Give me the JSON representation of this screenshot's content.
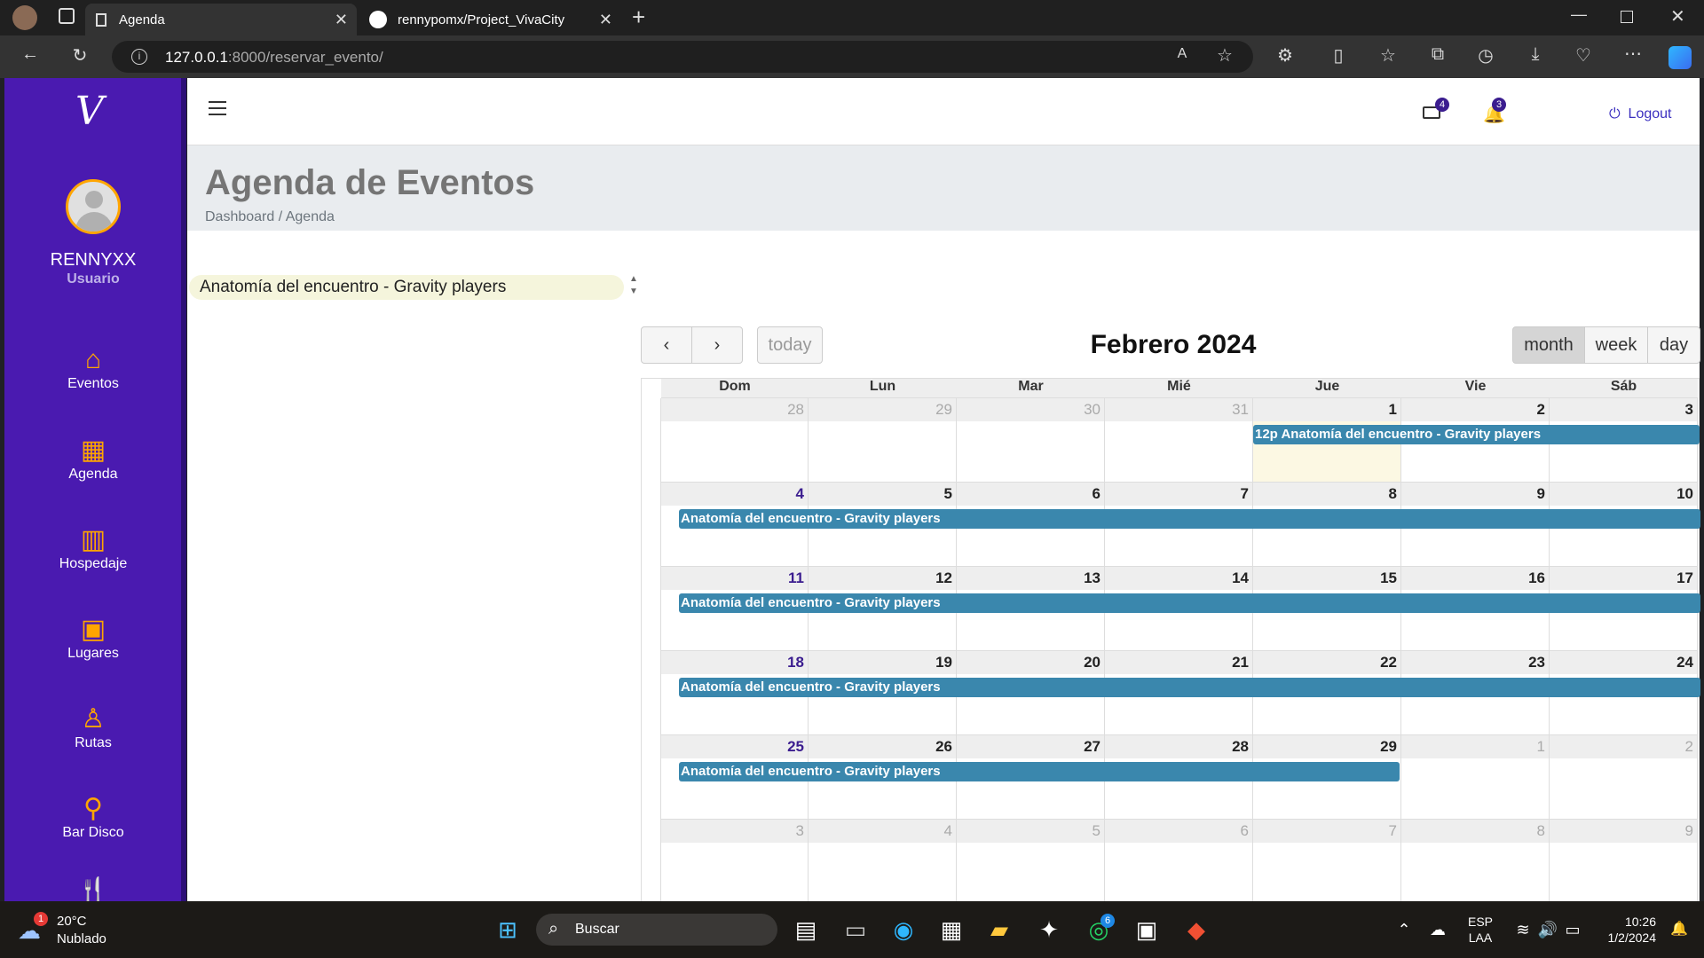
{
  "browser": {
    "tabs": [
      {
        "label": "Agenda",
        "active": true
      },
      {
        "label": "rennypomx/Project_VivaCity",
        "active": false
      }
    ],
    "url_host": "127.0.0.1",
    "url_path": ":8000/reservar_evento/"
  },
  "topnav": {
    "mail_count": "4",
    "notif_count": "3",
    "logout_label": "Logout"
  },
  "sidebar": {
    "username": "RENNYXX",
    "role": "Usuario",
    "items": [
      {
        "label": "Eventos",
        "icon": "home-icon"
      },
      {
        "label": "Agenda",
        "icon": "calendar-icon"
      },
      {
        "label": "Hospedaje",
        "icon": "building-icon"
      },
      {
        "label": "Lugares",
        "icon": "image-icon"
      },
      {
        "label": "Rutas",
        "icon": "person-pin-icon"
      },
      {
        "label": "Bar Disco",
        "icon": "bottle-icon"
      }
    ]
  },
  "page": {
    "title": "Agenda de Eventos",
    "breadcrumb": "Dashboard / Agenda"
  },
  "event_select": {
    "selected": "Anatomía del encuentro - Gravity players"
  },
  "calendar": {
    "title": "Febrero 2024",
    "today_label": "today",
    "views": [
      "month",
      "week",
      "day"
    ],
    "active_view": "month",
    "dow": [
      "Dom",
      "Lun",
      "Mar",
      "Mié",
      "Jue",
      "Vie",
      "Sáb"
    ],
    "weeks": [
      [
        "28",
        "29",
        "30",
        "31",
        "1",
        "2",
        "3"
      ],
      [
        "4",
        "5",
        "6",
        "7",
        "8",
        "9",
        "10"
      ],
      [
        "11",
        "12",
        "13",
        "14",
        "15",
        "16",
        "17"
      ],
      [
        "18",
        "19",
        "20",
        "21",
        "22",
        "23",
        "24"
      ],
      [
        "25",
        "26",
        "27",
        "28",
        "29",
        "1",
        "2"
      ],
      [
        "3",
        "4",
        "5",
        "6",
        "7",
        "8",
        "9"
      ]
    ],
    "first_event_label": "12p Anatomía del encuentro - Gravity players",
    "event_label": "Anatomía del encuentro - Gravity players"
  },
  "taskbar": {
    "weather_temp": "20°C",
    "weather_desc": "Nublado",
    "weather_badge": "1",
    "search_label": "Buscar",
    "whatsapp_badge": "6",
    "lang1": "ESP",
    "lang2": "LAA",
    "time": "10:26",
    "date": "1/2/2024"
  },
  "colors": {
    "sidebar": "#4a1ab0",
    "accent": "#ffa500",
    "event": "#3a87ad",
    "today": "#fcf8e3"
  }
}
